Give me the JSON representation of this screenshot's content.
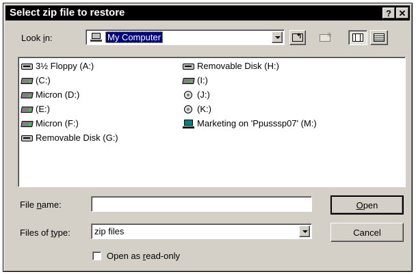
{
  "window": {
    "title": "Select zip file to restore",
    "help_label": "?",
    "close_label": "✕"
  },
  "lookin": {
    "label_pre": "Look ",
    "label_key": "i",
    "label_post": "n:",
    "value": "My Computer"
  },
  "toolbar": {
    "up_icon": "up-folder-icon",
    "newfolder_icon": "new-folder-icon",
    "list_icon": "list-view-icon",
    "details_icon": "details-view-icon"
  },
  "drives": [
    {
      "name": "3½ Floppy (A:)",
      "icon": "floppy-drive-icon"
    },
    {
      "name": "(C:)",
      "icon": "hard-drive-icon"
    },
    {
      "name": "Micron (D:)",
      "icon": "hard-drive-icon"
    },
    {
      "name": "(E:)",
      "icon": "hard-drive-icon"
    },
    {
      "name": "Micron (F:)",
      "icon": "hard-drive-icon"
    },
    {
      "name": "Removable Disk (G:)",
      "icon": "removable-disk-icon"
    },
    {
      "name": "Removable Disk (H:)",
      "icon": "removable-disk-icon"
    },
    {
      "name": "(I:)",
      "icon": "hard-drive-icon"
    },
    {
      "name": "(J:)",
      "icon": "cd-drive-icon"
    },
    {
      "name": "(K:)",
      "icon": "cd-drive-icon"
    },
    {
      "name": "Marketing on 'Ppusssp07' (M:)",
      "icon": "network-drive-icon"
    }
  ],
  "filename": {
    "label_pre": "File ",
    "label_key": "n",
    "label_post": "ame:",
    "value": ""
  },
  "filetype": {
    "label_pre": "Files of ",
    "label_key": "t",
    "label_post": "ype:",
    "value": "zip files"
  },
  "buttons": {
    "open_key": "O",
    "open_rest": "pen",
    "cancel": "Cancel"
  },
  "readonly": {
    "label_pre": "Open as ",
    "label_key": "r",
    "label_post": "ead-only",
    "checked": false
  }
}
